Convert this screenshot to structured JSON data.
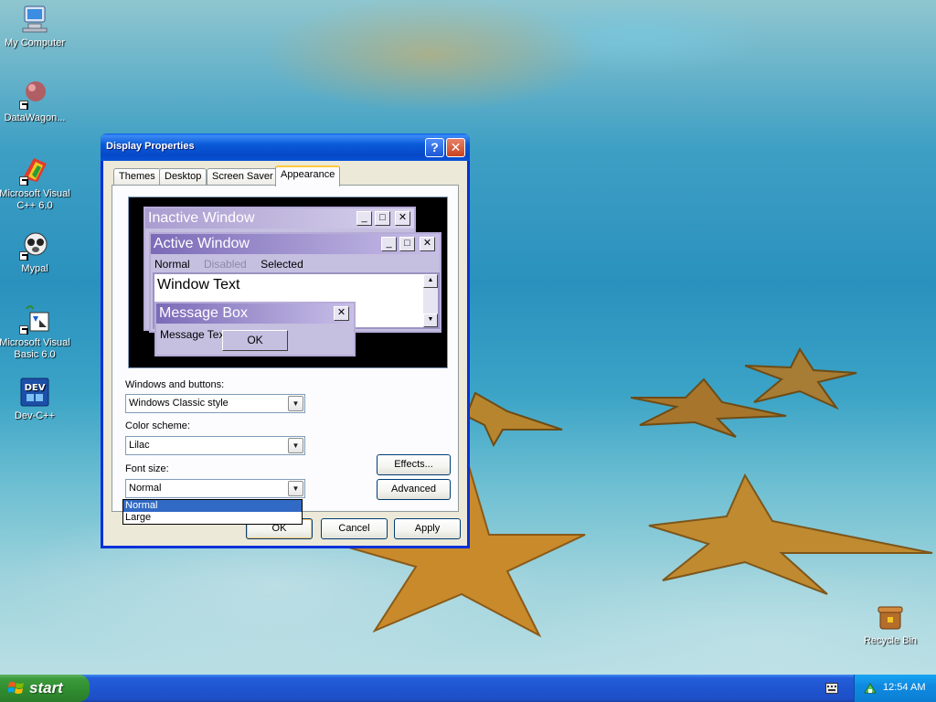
{
  "desktop": {
    "icons": [
      {
        "label": "My Computer",
        "icon": "my-computer-icon"
      },
      {
        "label": "DataWagon...",
        "icon": "datawagon-icon"
      },
      {
        "label": "Microsoft Visual C++ 6.0",
        "icon": "visual-cpp-icon"
      },
      {
        "label": "Mypal",
        "icon": "mypal-icon"
      },
      {
        "label": "Microsoft Visual Basic 6.0",
        "icon": "visual-basic-icon"
      },
      {
        "label": "Dev-C++",
        "icon": "dev-cpp-icon"
      },
      {
        "label": "Recycle Bin",
        "icon": "recycle-bin-icon"
      }
    ]
  },
  "window": {
    "title": "Display Properties",
    "help_glyph": "?",
    "close_glyph": "✕",
    "tabs": [
      {
        "label": "Themes"
      },
      {
        "label": "Desktop"
      },
      {
        "label": "Screen Saver"
      },
      {
        "label": "Appearance",
        "active": true
      }
    ]
  },
  "preview": {
    "inactive_title": "Inactive Window",
    "active_title": "Active Window",
    "menu": {
      "normal": "Normal",
      "disabled": "Disabled",
      "selected": "Selected"
    },
    "window_text": "Window Text",
    "message_box_title": "Message Box",
    "message_text": "Message Text",
    "ok_label": "OK",
    "min_glyph": "_",
    "max_glyph": "□",
    "close_glyph": "✕",
    "scroll_up": "▲",
    "scroll_down": "▼"
  },
  "appearance": {
    "windows_buttons_label": "Windows and buttons:",
    "windows_buttons_value": "Windows Classic style",
    "color_scheme_label": "Color scheme:",
    "color_scheme_value": "Lilac",
    "font_size_label": "Font size:",
    "font_size_value": "Normal",
    "font_size_options": [
      "Normal",
      "Large"
    ],
    "effects_label": "Effects...",
    "advanced_label": "Advanced",
    "combo_arrow": "▼"
  },
  "dialog_buttons": {
    "ok": "OK",
    "cancel": "Cancel",
    "apply": "Apply"
  },
  "taskbar": {
    "start_label": "start",
    "clock": "12:54 AM"
  },
  "colors": {
    "titlebar_blue": "#0a5ad8",
    "lilac_active_title": "#7b6bb8",
    "lilac_inactive_title": "#a99dd0",
    "selection_blue": "#316ac5",
    "start_green": "#3c9b3c"
  }
}
